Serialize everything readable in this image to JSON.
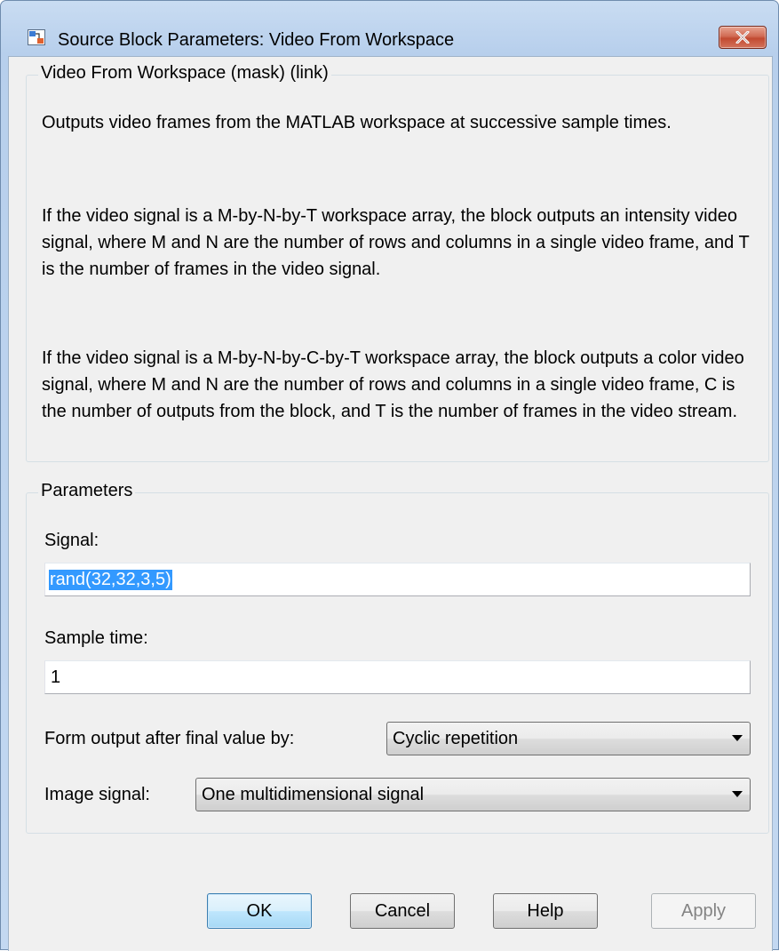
{
  "window": {
    "title": "Source Block Parameters: Video From Workspace",
    "accent_color": "#3399ff"
  },
  "description_group": {
    "label": "Video From Workspace (mask) (link)",
    "paragraphs": [
      "Outputs video frames from the MATLAB workspace at successive sample times.",
      "If the video signal is a M-by-N-by-T workspace array, the block outputs an intensity video signal, where M and N are the number of rows and columns in a single video frame, and T is the number of frames in the video signal.",
      "If the video signal is a M-by-N-by-C-by-T workspace array, the block outputs a color video signal, where M and N are the number of rows and columns in a single video frame, C is the number of outputs from the block, and T is the number of frames in the video stream."
    ]
  },
  "parameters_group": {
    "label": "Parameters",
    "signal": {
      "label": "Signal:",
      "value": "rand(32,32,3,5)"
    },
    "sample_time": {
      "label": "Sample time:",
      "value": "1"
    },
    "form_output": {
      "label": "Form output after final value by:",
      "value": "Cyclic repetition"
    },
    "image_signal": {
      "label": "Image signal:",
      "value": "One multidimensional signal"
    }
  },
  "buttons": {
    "ok": "OK",
    "cancel": "Cancel",
    "help": "Help",
    "apply": "Apply"
  }
}
